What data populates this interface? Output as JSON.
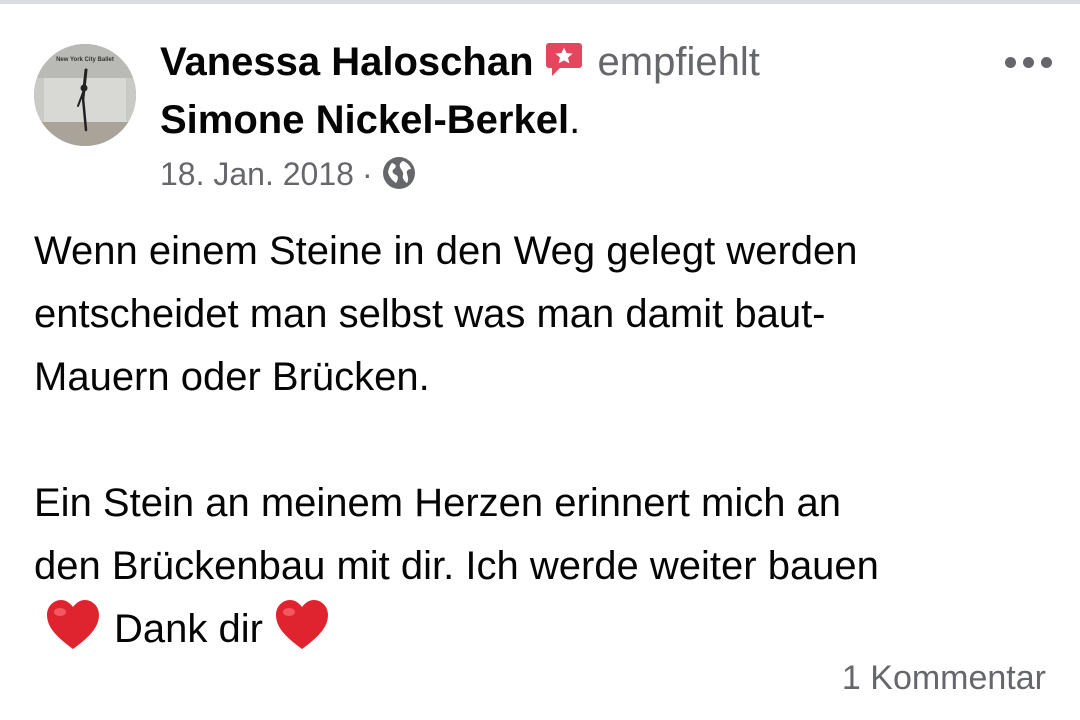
{
  "post": {
    "author": "Vanessa Haloschan",
    "author_badge_icon": "recommendation-badge-icon",
    "verb": "empfiehlt",
    "recommended_page": "Simone Nickel-Berkel",
    "period": ".",
    "date": "18. Jan. 2018",
    "separator": "·",
    "privacy_icon": "globe-icon",
    "avatar_text": "New York City Ballet",
    "text_lines_paragraph1": [
      "Wenn einem Steine in den Weg gelegt werden",
      "entscheidet man selbst was man damit baut-",
      "Mauern oder Brücken."
    ],
    "text_lines_paragraph2": [
      "Ein Stein an meinem Herzen erinnert mich an",
      "den Brückenbau mit dir. Ich werde weiter bauen"
    ],
    "last_line_text": "Dank dir",
    "heart_icon": "red-heart-icon",
    "comment_count": "1 Kommentar"
  },
  "colors": {
    "primary_text": "#050505",
    "secondary_text": "#65676b",
    "badge_red": "#e6455e",
    "heart_red": "#e0242f"
  }
}
